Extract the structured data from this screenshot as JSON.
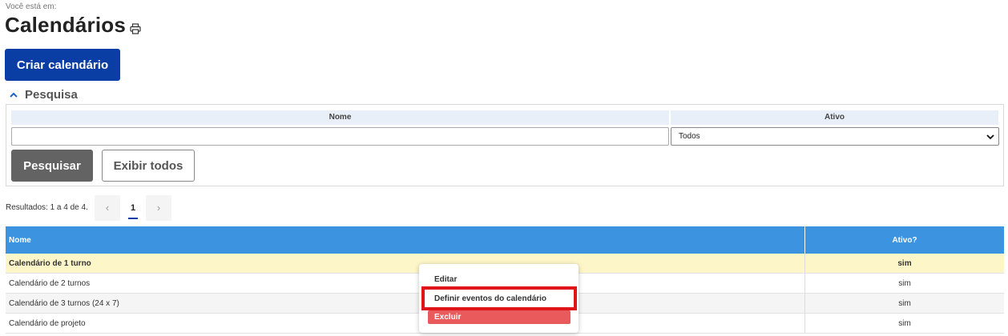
{
  "breadcrumb": "Você está em:",
  "page": {
    "title": "Calendários",
    "create_label": "Criar calendário"
  },
  "search": {
    "toggle_label": "Pesquisa",
    "nome_header": "Nome",
    "ativo_header": "Ativo",
    "nome_value": "",
    "ativo_value": "Todos",
    "search_label": "Pesquisar",
    "show_all_label": "Exibir todos"
  },
  "pagination": {
    "results_text": "Resultados: 1 a 4 de 4.",
    "current_page": "1",
    "prev_glyph": "‹",
    "next_glyph": "›"
  },
  "grid": {
    "headers": {
      "nome": "Nome",
      "ativo": "Ativo?"
    },
    "rows": [
      {
        "nome": "Calendário de 1 turno",
        "ativo": "sim"
      },
      {
        "nome": "Calendário de 2 turnos",
        "ativo": "sim"
      },
      {
        "nome": "Calendário de 3 turnos (24 x 7)",
        "ativo": "sim"
      },
      {
        "nome": "Calendário de projeto",
        "ativo": "sim"
      }
    ]
  },
  "context_menu": {
    "edit": "Editar",
    "define_events": "Definir eventos do calendário",
    "delete": "Excluir"
  },
  "icons": {
    "print": "print-icon",
    "toggle": "chevron-up-icon",
    "select": "caret-down-icon"
  },
  "colors": {
    "primary": "#0a3ea5",
    "grid_header": "#3c94e0",
    "selected_row": "#fdf6c8",
    "danger": "#e85a5c",
    "highlight": "#e0151a"
  }
}
